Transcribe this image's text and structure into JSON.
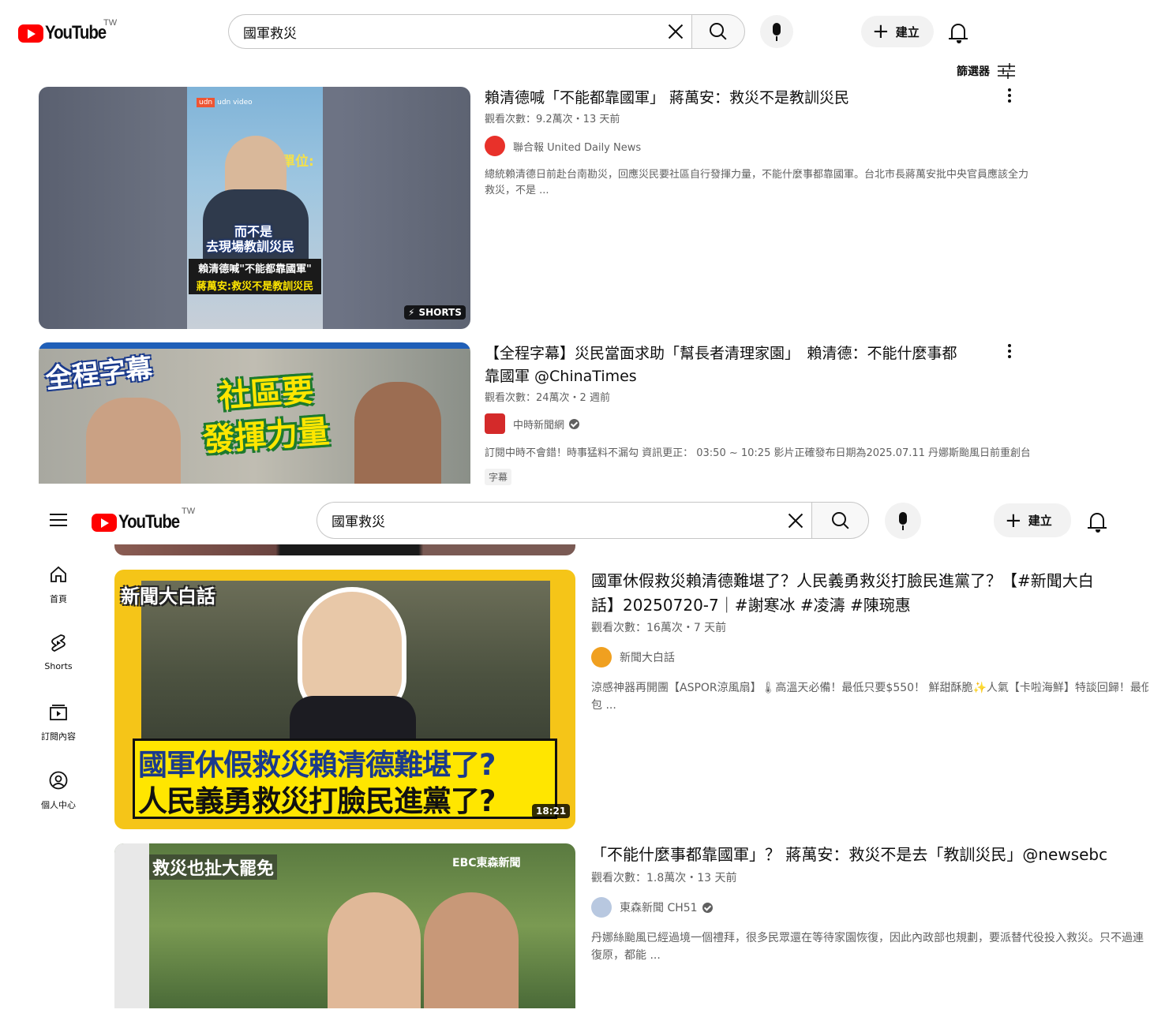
{
  "top": {
    "logo_text": "YouTube",
    "region": "TW",
    "search_value": "國軍救災",
    "create_label": "建立",
    "filter_label": "篩選器"
  },
  "bottom": {
    "logo_text": "YouTube",
    "region": "TW",
    "search_value": "國軍救災",
    "create_label": "建立"
  },
  "sidebar": {
    "items": [
      {
        "label": "首頁",
        "icon": "home-icon"
      },
      {
        "label": "Shorts",
        "icon": "shorts-icon"
      },
      {
        "label": "訂閱內容",
        "icon": "subscriptions-icon"
      },
      {
        "label": "個人中心",
        "icon": "you-icon"
      }
    ]
  },
  "results": [
    {
      "title": "賴清德喊「不能都靠國軍」 蔣萬安：救災不是教訓災民",
      "meta": "觀看次數：9.2萬次・13 天前",
      "channel": "聯合報 United Daily News",
      "verified": false,
      "description": "總統賴清德日前赴台南勘災，回應災民要社區自行發揮力量，不能什麼事都靠國軍。台北市長蔣萬安批中央官員應該全力救災，不是 ...",
      "overlay": "SHORTS",
      "thumb_brand": "udn video",
      "thumb_captions": [
        "而不是",
        "去現場教訓災民",
        "賴清德喊\"不能都靠國軍\"",
        "蔣萬安:救災不是教訓災民"
      ],
      "thumb_top_text": "單位:"
    },
    {
      "title_line1": "【全程字幕】災民當面求助「幫長者清理家園」　賴清德：不能什麼事都",
      "title_line2": "靠國軍 @ChinaTimes",
      "meta": "觀看次數：24萬次・2 週前",
      "channel": "中時新聞網",
      "verified": true,
      "description": "訂閱中時不會錯！時事猛料不漏勾 資訊更正： 03:50 ~ 10:25 影片正確發布日期為2025.07.11 丹娜斯颱風日前重創台...",
      "badge": "字幕",
      "thumb_captions": [
        "全程字幕",
        "社區要",
        "發揮力量"
      ]
    },
    {
      "title_line1": "國軍休假救災賴清德難堪了？人民義勇救災打臉民進黨了？【#新聞大白",
      "title_line2": "話】20250720-7｜#謝寒冰 #凌濤 #陳琬惠",
      "meta": "觀看次數：16萬次・7 天前",
      "channel": "新聞大白話",
      "verified": false,
      "description_line1": "涼感神器再開團【ASPOR涼風扇】🌡高溫天必備！最低只要$550！ 鮮甜酥脆✨人氣【卡啦海鮮】特談回歸！最低!",
      "description_line2": "包 ...",
      "duration": "18:21",
      "thumb_captions": [
        "新聞大白話",
        "國軍休假救災賴清德難堪了?",
        "人民義勇救災打臉民進黨了?"
      ]
    },
    {
      "title": "「不能什麼事都靠國軍」？ 蔣萬安：救災不是去「教訓災民」@newsebc",
      "meta": "觀看次數：1.8萬次・13 天前",
      "channel": "東森新聞 CH51",
      "verified": true,
      "description_line1": "丹娜絲颱風已經過境一個禮拜，很多民眾還在等待家園恢復，因此內政部也規劃，要派替代役投入救災。只不過連",
      "description_line2": "復原，都能 ...",
      "thumb_captions": [
        "救災也扯大罷免",
        "EBC東森新聞"
      ]
    }
  ],
  "colors": {
    "brand_red": "#ff0000",
    "text_primary": "#0f0f0f",
    "text_secondary": "#606060",
    "caption_yellow": "#ffe600",
    "caption_blue": "#1a3a8c"
  }
}
